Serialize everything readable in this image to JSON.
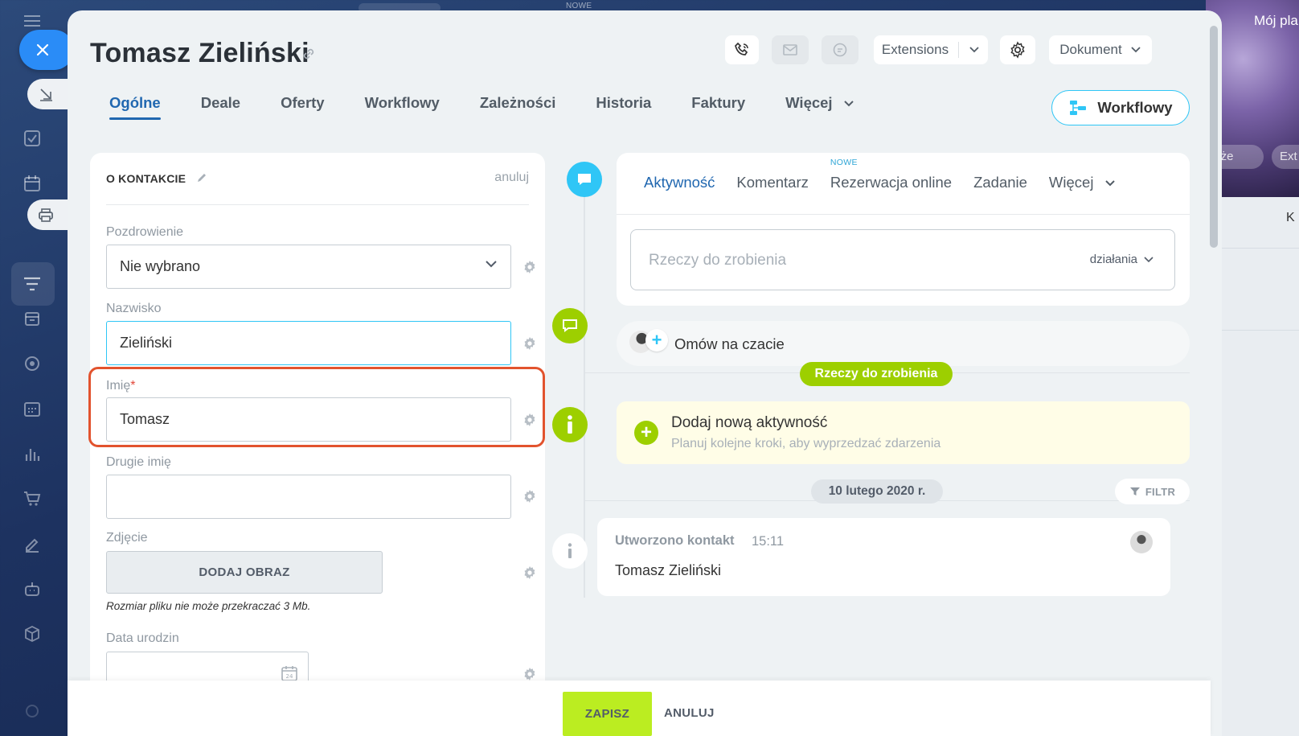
{
  "topbar": {
    "nowe_label": "NOWE"
  },
  "background": {
    "right_title": "Mój pla",
    "pill_a": "daże",
    "pill_b": "Ext",
    "right_letter": "K"
  },
  "header": {
    "title": "Tomasz Zieliński",
    "extensions_label": "Extensions",
    "document_label": "Dokument"
  },
  "tabs": [
    {
      "label": "Ogólne",
      "active": true
    },
    {
      "label": "Deale"
    },
    {
      "label": "Oferty"
    },
    {
      "label": "Workflowy"
    },
    {
      "label": "Zależności"
    },
    {
      "label": "Historia"
    },
    {
      "label": "Faktury"
    },
    {
      "label": "Więcej"
    }
  ],
  "workflow_button": "Workflowy",
  "contact": {
    "section_title": "O KONTAKCIE",
    "cancel_link": "anuluj",
    "fields": {
      "greeting_label": "Pozdrowienie",
      "greeting_value": "Nie wybrano",
      "surname_label": "Nazwisko",
      "surname_value": "Zieliński",
      "name_label": "Imię",
      "name_required": "*",
      "name_value": "Tomasz",
      "middle_label": "Drugie imię",
      "middle_value": "",
      "photo_label": "Zdjęcie",
      "photo_button": "DODAJ OBRAZ",
      "photo_hint": "Rozmiar pliku nie może przekraczać 3 Mb.",
      "birth_label": "Data urodzin",
      "calendar_day": "24"
    }
  },
  "activity": {
    "tabs": [
      {
        "label": "Aktywność",
        "active": true
      },
      {
        "label": "Komentarz"
      },
      {
        "label": "Rezerwacja online",
        "badge": "NOWE"
      },
      {
        "label": "Zadanie"
      },
      {
        "label": "Więcej"
      }
    ],
    "input_placeholder": "Rzeczy do zrobienia",
    "input_menu": "działania",
    "chat_text": "Omów na czacie",
    "todo_badge": "Rzeczy do zrobienia",
    "add_title": "Dodaj nową aktywność",
    "add_subtitle": "Planuj kolejne kroki, aby wyprzedzać zdarzenia",
    "date_badge": "10 lutego 2020 r.",
    "filter_label": "FILTR",
    "history": {
      "title": "Utworzono kontakt",
      "time": "15:11",
      "name": "Tomasz Zieliński"
    }
  },
  "footer": {
    "save_label": "ZAPISZ",
    "cancel_label": "ANULUJ"
  },
  "colors": {
    "accent_blue": "#2067b0",
    "cyan": "#2fc6f6",
    "green": "#9dcf00",
    "save_green": "#bbed21",
    "highlight_red": "#e2532e"
  }
}
